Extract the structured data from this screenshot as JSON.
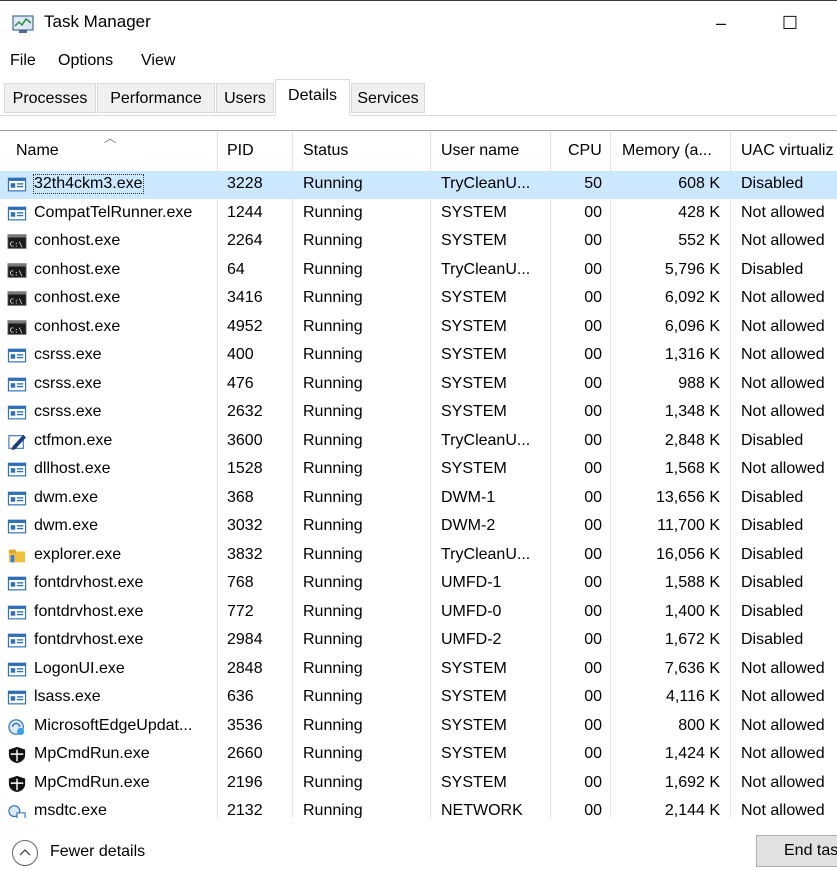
{
  "window": {
    "title": "Task Manager",
    "minimize": "–",
    "maximize": "☐"
  },
  "menu": [
    "File",
    "Options",
    "View"
  ],
  "tabs": [
    "Processes",
    "Performance",
    "Users",
    "Details",
    "Services"
  ],
  "active_tab": "Details",
  "columns": {
    "name": "Name",
    "pid": "PID",
    "status": "Status",
    "user": "User name",
    "cpu": "CPU",
    "memory": "Memory (a...",
    "uac": "UAC virtualiz"
  },
  "rows": [
    {
      "icon": "app-window-icon",
      "name": "32th4ckm3.exe",
      "pid": "3228",
      "status": "Running",
      "user": "TryCleanU...",
      "cpu": "50",
      "memory": "608 K",
      "uac": "Disabled"
    },
    {
      "icon": "app-window-icon",
      "name": "CompatTelRunner.exe",
      "pid": "1244",
      "status": "Running",
      "user": "SYSTEM",
      "cpu": "00",
      "memory": "428 K",
      "uac": "Not allowed"
    },
    {
      "icon": "console-icon",
      "name": "conhost.exe",
      "pid": "2264",
      "status": "Running",
      "user": "SYSTEM",
      "cpu": "00",
      "memory": "552 K",
      "uac": "Not allowed"
    },
    {
      "icon": "console-icon",
      "name": "conhost.exe",
      "pid": "64",
      "status": "Running",
      "user": "TryCleanU...",
      "cpu": "00",
      "memory": "5,796 K",
      "uac": "Disabled"
    },
    {
      "icon": "console-icon",
      "name": "conhost.exe",
      "pid": "3416",
      "status": "Running",
      "user": "SYSTEM",
      "cpu": "00",
      "memory": "6,092 K",
      "uac": "Not allowed"
    },
    {
      "icon": "console-icon",
      "name": "conhost.exe",
      "pid": "4952",
      "status": "Running",
      "user": "SYSTEM",
      "cpu": "00",
      "memory": "6,096 K",
      "uac": "Not allowed"
    },
    {
      "icon": "app-window-icon",
      "name": "csrss.exe",
      "pid": "400",
      "status": "Running",
      "user": "SYSTEM",
      "cpu": "00",
      "memory": "1,316 K",
      "uac": "Not allowed"
    },
    {
      "icon": "app-window-icon",
      "name": "csrss.exe",
      "pid": "476",
      "status": "Running",
      "user": "SYSTEM",
      "cpu": "00",
      "memory": "988 K",
      "uac": "Not allowed"
    },
    {
      "icon": "app-window-icon",
      "name": "csrss.exe",
      "pid": "2632",
      "status": "Running",
      "user": "SYSTEM",
      "cpu": "00",
      "memory": "1,348 K",
      "uac": "Not allowed"
    },
    {
      "icon": "pen-icon",
      "name": "ctfmon.exe",
      "pid": "3600",
      "status": "Running",
      "user": "TryCleanU...",
      "cpu": "00",
      "memory": "2,848 K",
      "uac": "Disabled"
    },
    {
      "icon": "app-window-icon",
      "name": "dllhost.exe",
      "pid": "1528",
      "status": "Running",
      "user": "SYSTEM",
      "cpu": "00",
      "memory": "1,568 K",
      "uac": "Not allowed"
    },
    {
      "icon": "app-window-icon",
      "name": "dwm.exe",
      "pid": "368",
      "status": "Running",
      "user": "DWM-1",
      "cpu": "00",
      "memory": "13,656 K",
      "uac": "Disabled"
    },
    {
      "icon": "app-window-icon",
      "name": "dwm.exe",
      "pid": "3032",
      "status": "Running",
      "user": "DWM-2",
      "cpu": "00",
      "memory": "11,700 K",
      "uac": "Disabled"
    },
    {
      "icon": "folder-icon",
      "name": "explorer.exe",
      "pid": "3832",
      "status": "Running",
      "user": "TryCleanU...",
      "cpu": "00",
      "memory": "16,056 K",
      "uac": "Disabled"
    },
    {
      "icon": "app-window-icon",
      "name": "fontdrvhost.exe",
      "pid": "768",
      "status": "Running",
      "user": "UMFD-1",
      "cpu": "00",
      "memory": "1,588 K",
      "uac": "Disabled"
    },
    {
      "icon": "app-window-icon",
      "name": "fontdrvhost.exe",
      "pid": "772",
      "status": "Running",
      "user": "UMFD-0",
      "cpu": "00",
      "memory": "1,400 K",
      "uac": "Disabled"
    },
    {
      "icon": "app-window-icon",
      "name": "fontdrvhost.exe",
      "pid": "2984",
      "status": "Running",
      "user": "UMFD-2",
      "cpu": "00",
      "memory": "1,672 K",
      "uac": "Disabled"
    },
    {
      "icon": "app-window-icon",
      "name": "LogonUI.exe",
      "pid": "2848",
      "status": "Running",
      "user": "SYSTEM",
      "cpu": "00",
      "memory": "7,636 K",
      "uac": "Not allowed"
    },
    {
      "icon": "app-window-icon",
      "name": "lsass.exe",
      "pid": "636",
      "status": "Running",
      "user": "SYSTEM",
      "cpu": "00",
      "memory": "4,116 K",
      "uac": "Not allowed"
    },
    {
      "icon": "edge-update-icon",
      "name": "MicrosoftEdgeUpdat...",
      "pid": "3536",
      "status": "Running",
      "user": "SYSTEM",
      "cpu": "00",
      "memory": "800 K",
      "uac": "Not allowed"
    },
    {
      "icon": "shield-icon",
      "name": "MpCmdRun.exe",
      "pid": "2660",
      "status": "Running",
      "user": "SYSTEM",
      "cpu": "00",
      "memory": "1,424 K",
      "uac": "Not allowed"
    },
    {
      "icon": "shield-icon",
      "name": "MpCmdRun.exe",
      "pid": "2196",
      "status": "Running",
      "user": "SYSTEM",
      "cpu": "00",
      "memory": "1,692 K",
      "uac": "Not allowed"
    },
    {
      "icon": "network-service-icon",
      "name": "msdtc.exe",
      "pid": "2132",
      "status": "Running",
      "user": "NETWORK",
      "cpu": "00",
      "memory": "2,144 K",
      "uac": "Not allowed"
    }
  ],
  "selected_row": 0,
  "footer": {
    "fewer_details": "Fewer details",
    "end_task": "End task"
  },
  "colors": {
    "selected_row": "#cce8ff",
    "header_separator": "#e5e5e5"
  }
}
